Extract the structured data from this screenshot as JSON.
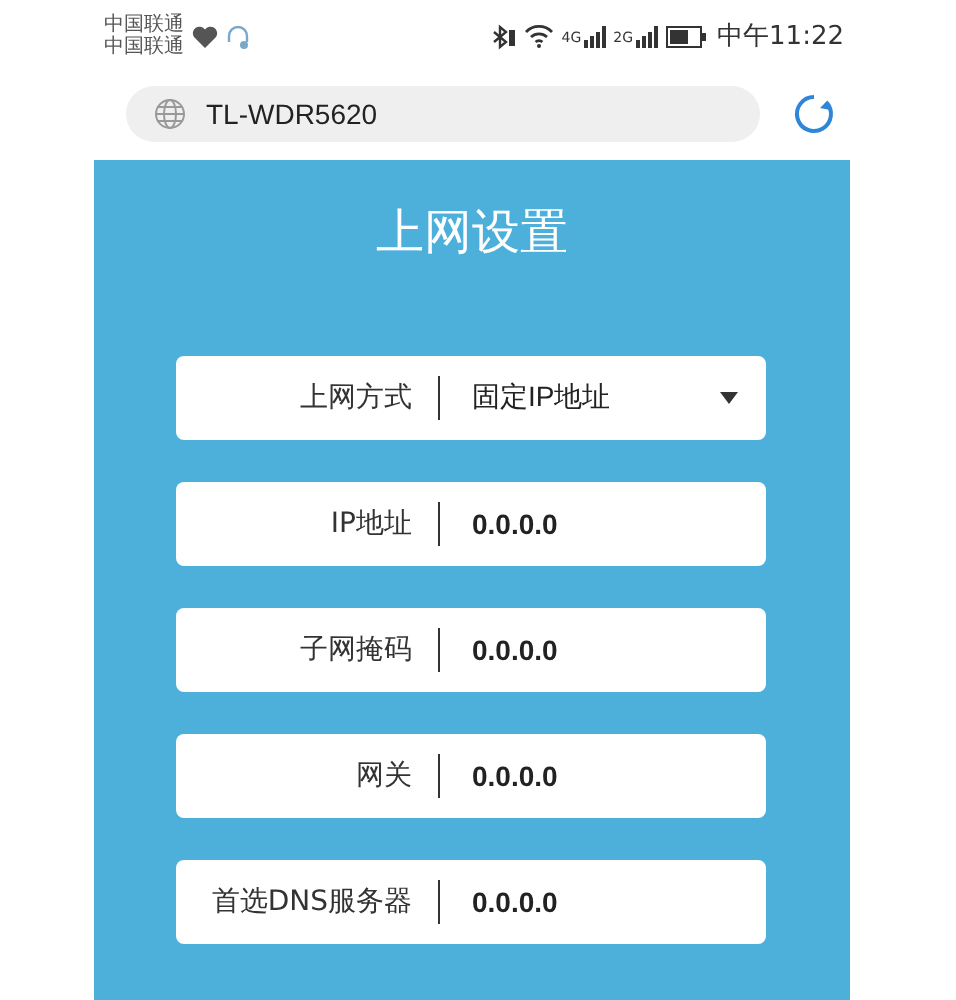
{
  "status_bar": {
    "carriers": [
      "中国联通",
      "中国联通"
    ],
    "network_labels": [
      "4G",
      "2G"
    ],
    "time": "中午11:22"
  },
  "address_bar": {
    "url": "TL-WDR5620"
  },
  "panel": {
    "title": "上网设置",
    "fields": [
      {
        "kind": "select",
        "label": "上网方式",
        "value": "固定IP地址"
      },
      {
        "kind": "text",
        "label": "IP地址",
        "value": "0.0.0.0"
      },
      {
        "kind": "text",
        "label": "子网掩码",
        "value": "0.0.0.0"
      },
      {
        "kind": "text",
        "label": "网关",
        "value": "0.0.0.0"
      },
      {
        "kind": "text",
        "label": "首选DNS服务器",
        "value": "0.0.0.0"
      }
    ]
  }
}
